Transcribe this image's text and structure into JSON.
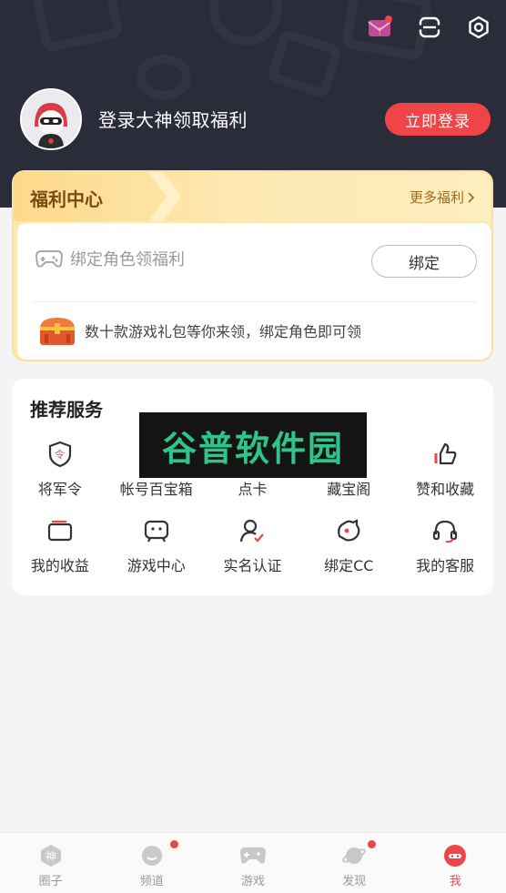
{
  "header": {
    "login_text": "登录大神领取福利",
    "login_button": "立即登录",
    "icons": [
      "message-icon",
      "scan-icon",
      "settings-icon"
    ]
  },
  "welfare": {
    "title": "福利中心",
    "more": "更多福利",
    "bind_text": "绑定角色领福利",
    "bind_button": "绑定",
    "gift_text": "数十款游戏礼包等你来领，绑定角色即可领"
  },
  "services": {
    "title": "推荐服务",
    "items": [
      {
        "label": "将军令",
        "icon": "token-shield-icon"
      },
      {
        "label": "帐号百宝箱",
        "icon": "treasure-box-icon"
      },
      {
        "label": "点卡",
        "icon": "card-icon"
      },
      {
        "label": "藏宝阁",
        "icon": "treasure-pavilion-icon"
      },
      {
        "label": "赞和收藏",
        "icon": "thumbs-up-icon"
      },
      {
        "label": "我的收益",
        "icon": "wallet-icon"
      },
      {
        "label": "游戏中心",
        "icon": "gamepad-face-icon"
      },
      {
        "label": "实名认证",
        "icon": "user-verify-icon"
      },
      {
        "label": "绑定CC",
        "icon": "cc-icon"
      },
      {
        "label": "我的客服",
        "icon": "headset-icon"
      }
    ]
  },
  "watermark": "谷普软件园",
  "tabbar": {
    "items": [
      {
        "label": "圈子",
        "icon": "circle-shen-icon",
        "badge": false
      },
      {
        "label": "频道",
        "icon": "channel-icon",
        "badge": true
      },
      {
        "label": "游戏",
        "icon": "gamepad-icon",
        "badge": false
      },
      {
        "label": "发现",
        "icon": "planet-icon",
        "badge": true
      },
      {
        "label": "我",
        "icon": "me-icon",
        "badge": false,
        "active": true
      }
    ]
  },
  "colors": {
    "header_bg": "#2a2c3a",
    "accent": "#ef4549",
    "welfare_bg": "#fde8b0"
  }
}
